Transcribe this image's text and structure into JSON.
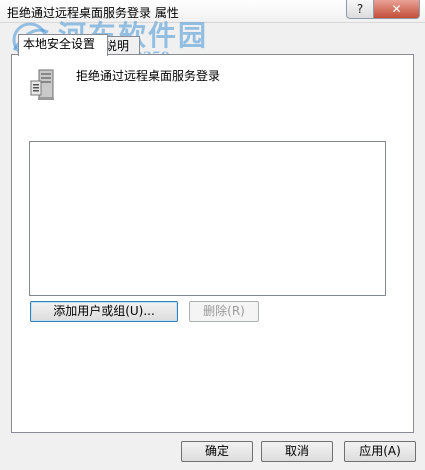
{
  "window": {
    "title": "拒绝通过远程桌面服务登录 属性",
    "help_label": "?",
    "close_label": "✕"
  },
  "watermark": {
    "title": "河东软件园",
    "url": "www.pc0359.cn"
  },
  "tabs": [
    {
      "label": "本地安全设置",
      "active": true
    },
    {
      "label": "说明",
      "active": false
    }
  ],
  "policy": {
    "name": "拒绝通过远程桌面服务登录",
    "icon": "server-icon"
  },
  "accounts": [],
  "buttons": {
    "add": "添加用户或组(U)...",
    "remove": "删除(R)",
    "ok": "确定",
    "cancel": "取消",
    "apply": "应用(A)"
  }
}
